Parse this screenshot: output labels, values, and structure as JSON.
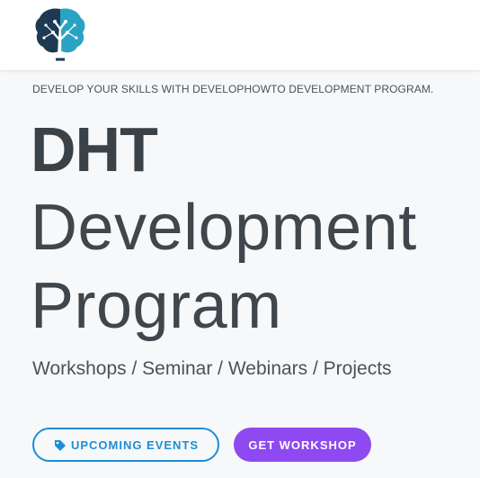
{
  "header": {
    "logo_icon": "brain-tree-logo",
    "colors": {
      "logo_dark": "#1d3a52",
      "logo_light": "#2aa3c2"
    }
  },
  "hero": {
    "tagline": "DEVELOP YOUR SKILLS WITH DEVELOPHOWTO DEVELOPMENT PROGRAM.",
    "title_bold": "DHT",
    "title_line1": "Development",
    "title_line2": "Program",
    "subtitle": "Workshops / Seminar / Webinars / Projects"
  },
  "actions": {
    "upcoming_events": {
      "label": "UPCOMING EVENTS",
      "icon": "tag-icon",
      "color": "#1a8fd6"
    },
    "get_workshop": {
      "label": "GET WORKSHOP",
      "color": "#8e49f0"
    }
  }
}
